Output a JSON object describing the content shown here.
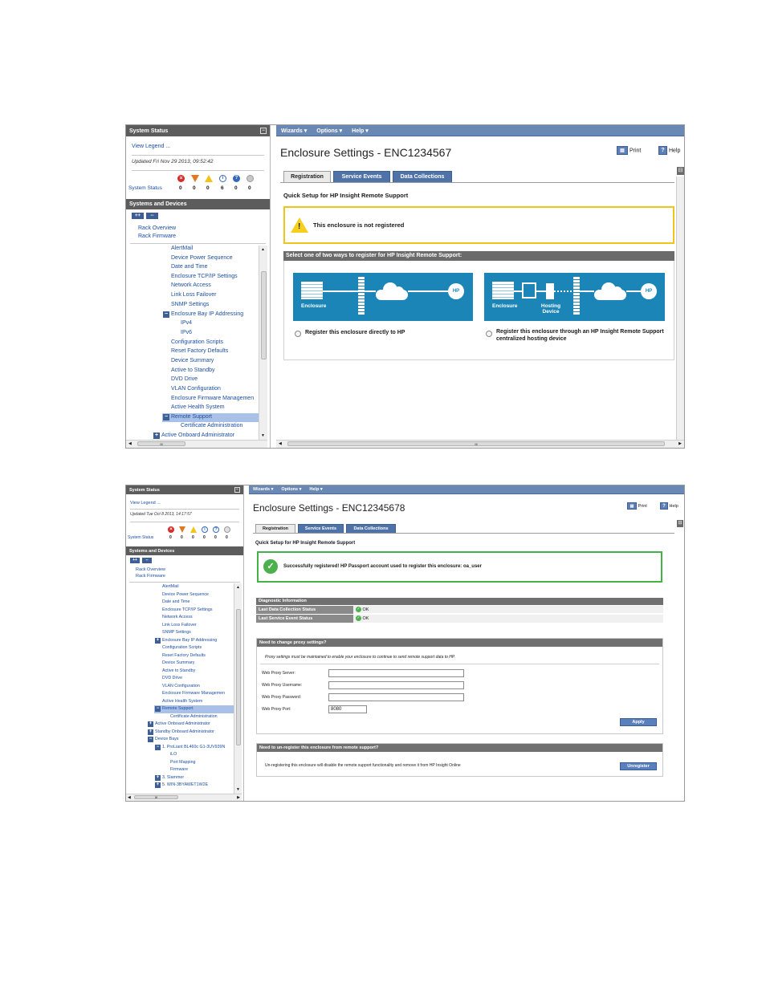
{
  "s1": {
    "left": {
      "system_status_title": "System Status",
      "view_legend": "View Legend ...",
      "updated": "Updated Fri Nov 29 2013, 09:52:42",
      "system_status_label": "System Status",
      "status_counts": [
        "0",
        "0",
        "0",
        "6",
        "0",
        "0"
      ],
      "systems_devices_title": "Systems and Devices",
      "expand_label": "++",
      "collapse_label": "--",
      "rack_overview": "Rack Overview",
      "rack_firmware": "Rack Firmware",
      "tree": [
        "AlertMail",
        "Device Power Sequence",
        "Date and Time",
        "Enclosure TCP/IP Settings",
        "Network Access",
        "Link Loss Failover",
        "SNMP Settings",
        "Enclosure Bay IP Addressing",
        "IPv4",
        "IPv6",
        "Configuration Scripts",
        "Reset Factory Defaults",
        "Device Summary",
        "Active to Standby",
        "DVD Drive",
        "VLAN Configuration",
        "Enclosure Firmware Managemen",
        "Active Health System",
        "Remote Support",
        "Certificate Administration",
        "Active Onboard Administrator"
      ],
      "hscroll_grip": "III"
    },
    "right": {
      "menu": [
        "Wizards ▾",
        "Options ▾",
        "Help ▾"
      ],
      "title": "Enclosure Settings - ENC1234567",
      "print": "Print",
      "help": "Help",
      "tabs": [
        "Registration",
        "Service Events",
        "Data Collections"
      ],
      "quick_setup": "Quick Setup for HP Insight Remote Support",
      "warning": "This enclosure is not registered",
      "select_bar": "Select one of two ways to register for HP Insight Remote Support:",
      "diagram1_enclosure": "Enclosure",
      "diagram2_enclosure": "Enclosure",
      "diagram2_hosting": "Hosting Device",
      "hp": "HP",
      "option1": "Register this enclosure directly to HP",
      "option2": "Register this enclosure through an HP Insight Remote Support centralized hosting device",
      "hscroll_grip": "III"
    }
  },
  "s2": {
    "left": {
      "system_status_title": "System Status",
      "view_legend": "View Legend ...",
      "updated": "Updated Tue Oct 8 2013, 14:17:57",
      "system_status_label": "System Status",
      "status_counts": [
        "0",
        "0",
        "0",
        "0",
        "0",
        "0"
      ],
      "systems_devices_title": "Systems and Devices",
      "expand_label": "++",
      "collapse_label": "--",
      "rack_overview": "Rack Overview",
      "rack_firmware": "Rack Firmware",
      "tree": [
        "AlertMail",
        "Device Power Sequence",
        "Date and Time",
        "Enclosure TCP/IP Settings",
        "Network Access",
        "Link Loss Failover",
        "SNMP Settings",
        "Enclosure Bay IP Addressing",
        "Configuration Scripts",
        "Reset Factory Defaults",
        "Device Summary",
        "Active to Standby",
        "DVD Drive",
        "VLAN Configuration",
        "Enclosure Firmware Managemen",
        "Active Health System",
        "Remote Support",
        "Certificate Administration",
        "Active Onboard Administrator",
        "Standby Onboard Administrator",
        "Device Bays",
        "1. ProLiant BL460c G1-3UV939N",
        "iLO",
        "Port Mapping",
        "Firmware",
        "3. Slammer",
        "5. WIN-3BYAWET1W2E"
      ],
      "hscroll_grip": "III"
    },
    "right": {
      "menu": [
        "Wizards ▾",
        "Options ▾",
        "Help ▾"
      ],
      "title": "Enclosure Settings - ENC12345678",
      "print": "Print",
      "help": "Help",
      "tabs": [
        "Registration",
        "Service Events",
        "Data Collections"
      ],
      "quick_setup": "Quick Setup for HP Insight Remote Support",
      "success": "Successfully registered!  HP Passport account used to register this enclosure:  oa_user",
      "diag_title": "Diagnostic Information",
      "diag_rows": [
        {
          "label": "Last Data Collection Status",
          "value": "OK"
        },
        {
          "label": "Last Service Event Status",
          "value": "OK"
        }
      ],
      "proxy_title": "Need to change proxy settings?",
      "proxy_note": "Proxy settings must be maintained to enable your enclosure to continue to send remote support data to HP.",
      "proxy_server_label": "Web Proxy Server:",
      "proxy_user_label": "Web Proxy Username:",
      "proxy_pass_label": "Web Proxy Password:",
      "proxy_port_label": "Web Proxy Port:",
      "proxy_port_value": "8080",
      "apply": "Apply",
      "unreg_title": "Need to un-register this enclosure from remote support?",
      "unreg_text": "Un-registering this enclosure will disable the remote support functionality and remove it from HP Insight Online",
      "unregister": "Unregister"
    }
  }
}
